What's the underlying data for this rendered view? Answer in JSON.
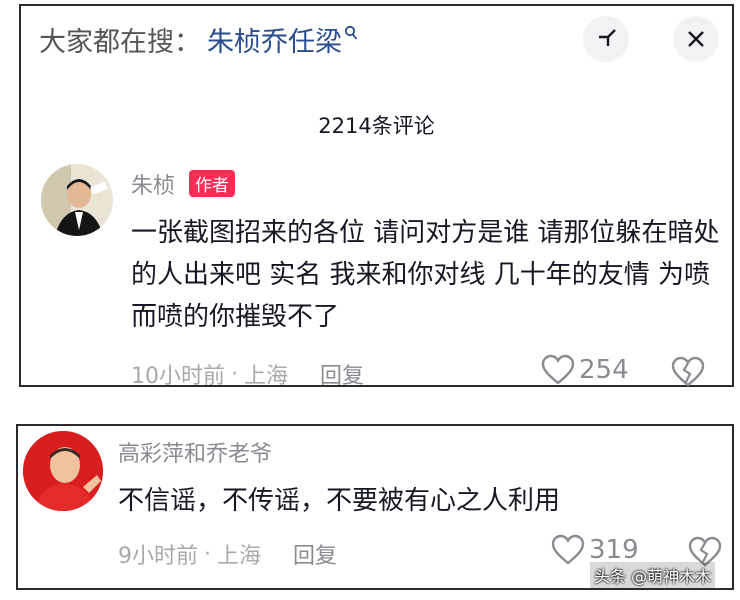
{
  "search": {
    "prefix": "大家都在搜：",
    "term": "朱桢乔任梁"
  },
  "header": {
    "comment_count": "2214条评论"
  },
  "comments": [
    {
      "username": "朱桢",
      "badge": "作者",
      "text": "一张截图招来的各位 请问对方是谁 请那位躲在暗处的人出来吧 实名 我来和你对线 几十年的友情 为喷而喷的你摧毁不了",
      "time": "10小时前",
      "location": "上海",
      "reply_label": "回复",
      "likes": "254"
    },
    {
      "username": "高彩萍和乔老爷",
      "text": "不信谣，不传谣，不要被有心之人利用",
      "time": "9小时前",
      "location": "上海",
      "reply_label": "回复",
      "likes": "319"
    }
  ],
  "watermark": "头条 @萌神木木",
  "icons": {
    "expand": "minimize-icon",
    "close": "close-icon",
    "like": "heart-icon",
    "dislike": "broken-heart-icon"
  },
  "colors": {
    "badge": "#fe2c55",
    "search_term": "#2a4d8f"
  }
}
